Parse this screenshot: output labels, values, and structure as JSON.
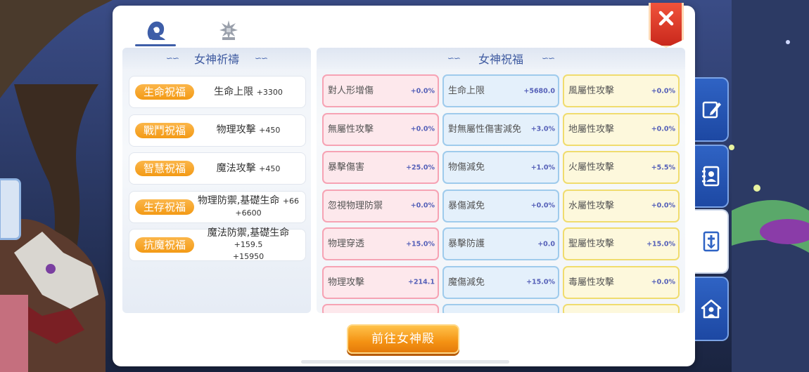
{
  "tabs": [
    {
      "icon": "goddess-portrait-icon",
      "active": true
    },
    {
      "icon": "winged-crest-icon",
      "active": false
    }
  ],
  "close_icon": "close-icon",
  "left_section": {
    "title": "女神祈禱",
    "blessings": [
      {
        "tag": "生命祝福",
        "text": "生命上限",
        "bonus": "+3300",
        "bonus2": ""
      },
      {
        "tag": "戰鬥祝福",
        "text": "物理攻擊",
        "bonus": "+450",
        "bonus2": ""
      },
      {
        "tag": "智慧祝福",
        "text": "魔法攻擊",
        "bonus": "+450",
        "bonus2": ""
      },
      {
        "tag": "生存祝福",
        "text": "物理防禦,基礎生命",
        "bonus": "+66",
        "bonus2": "+6600"
      },
      {
        "tag": "抗魔祝福",
        "text": "魔法防禦,基礎生命",
        "bonus": "+159.5",
        "bonus2": "+15950"
      }
    ]
  },
  "right_section": {
    "title": "女神祝福",
    "stats": [
      {
        "name": "對人形增傷",
        "value": "+0.0%",
        "color": "pink"
      },
      {
        "name": "生命上限",
        "value": "+5680.0",
        "color": "blue"
      },
      {
        "name": "風屬性攻擊",
        "value": "+0.0%",
        "color": "yellow"
      },
      {
        "name": "無屬性攻擊",
        "value": "+0.0%",
        "color": "pink"
      },
      {
        "name": "對無屬性傷害減免",
        "value": "+3.0%",
        "color": "blue"
      },
      {
        "name": "地屬性攻擊",
        "value": "+0.0%",
        "color": "yellow"
      },
      {
        "name": "暴擊傷害",
        "value": "+25.0%",
        "color": "pink"
      },
      {
        "name": "物傷減免",
        "value": "+1.0%",
        "color": "blue"
      },
      {
        "name": "火屬性攻擊",
        "value": "+5.5%",
        "color": "yellow"
      },
      {
        "name": "忽視物理防禦",
        "value": "+0.0%",
        "color": "pink"
      },
      {
        "name": "暴傷減免",
        "value": "+0.0%",
        "color": "blue"
      },
      {
        "name": "水屬性攻擊",
        "value": "+0.0%",
        "color": "yellow"
      },
      {
        "name": "物理穿透",
        "value": "+15.0%",
        "color": "pink"
      },
      {
        "name": "暴擊防護",
        "value": "+0.0",
        "color": "blue"
      },
      {
        "name": "聖屬性攻擊",
        "value": "+15.0%",
        "color": "yellow"
      },
      {
        "name": "物理攻擊",
        "value": "+214.1",
        "color": "pink"
      },
      {
        "name": "魔傷減免",
        "value": "+15.0%",
        "color": "blue"
      },
      {
        "name": "毒屬性攻擊",
        "value": "+0.0%",
        "color": "yellow"
      }
    ]
  },
  "go_button": "前往女神殿",
  "side_tabs": [
    {
      "icon": "edit-note-icon",
      "active": false
    },
    {
      "icon": "contact-book-icon",
      "active": false
    },
    {
      "icon": "cross-shield-icon",
      "active": true
    },
    {
      "icon": "guild-house-icon",
      "active": false
    }
  ],
  "colors": {
    "accent_blue": "#3e5aa0",
    "orange": "#f39a15",
    "close_red": "#d9301f",
    "pink_border": "#f6a3b4",
    "blue_border": "#9fcbec",
    "yellow_border": "#f0dc6e"
  }
}
